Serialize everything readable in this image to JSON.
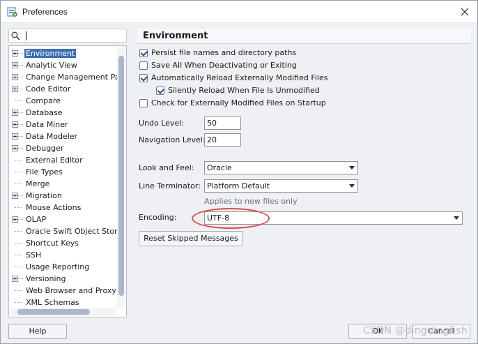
{
  "window": {
    "title": "Preferences",
    "icons": {
      "app": "preferences-app-icon",
      "close": "close-icon"
    }
  },
  "search": {
    "value": "",
    "placeholder": "",
    "icon": "search-icon"
  },
  "tree": {
    "items": [
      {
        "label": "Environment",
        "expandable": true,
        "selected": true
      },
      {
        "label": "Analytic View",
        "expandable": true
      },
      {
        "label": "Change Management Paran",
        "expandable": true
      },
      {
        "label": "Code Editor",
        "expandable": true
      },
      {
        "label": "Compare",
        "expandable": false
      },
      {
        "label": "Database",
        "expandable": true
      },
      {
        "label": "Data Miner",
        "expandable": true
      },
      {
        "label": "Data Modeler",
        "expandable": true
      },
      {
        "label": "Debugger",
        "expandable": true
      },
      {
        "label": "External Editor",
        "expandable": false
      },
      {
        "label": "File Types",
        "expandable": false
      },
      {
        "label": "Merge",
        "expandable": false
      },
      {
        "label": "Migration",
        "expandable": true
      },
      {
        "label": "Mouse Actions",
        "expandable": false
      },
      {
        "label": "OLAP",
        "expandable": true
      },
      {
        "label": "Oracle Swift Object Storage",
        "expandable": false
      },
      {
        "label": "Shortcut Keys",
        "expandable": false
      },
      {
        "label": "SSH",
        "expandable": false
      },
      {
        "label": "Usage Reporting",
        "expandable": false
      },
      {
        "label": "Versioning",
        "expandable": true
      },
      {
        "label": "Web Browser and Proxy",
        "expandable": false
      },
      {
        "label": "XML Schemas",
        "expandable": false
      }
    ]
  },
  "environment": {
    "title": "Environment",
    "checkboxes": [
      {
        "label": "Persist file names and directory paths",
        "checked": true
      },
      {
        "label": "Save All When Deactivating or Exiting",
        "checked": false
      },
      {
        "label": "Automatically Reload Externally Modified Files",
        "checked": true
      },
      {
        "label": "Silently Reload When File Is Unmodified",
        "checked": true
      },
      {
        "label": "Check for Externally Modified Files on Startup",
        "checked": false
      }
    ],
    "undo_level": {
      "label": "Undo Level:",
      "value": "50"
    },
    "navigation_level": {
      "label": "Navigation Level:",
      "value": "20"
    },
    "look_and_feel": {
      "label": "Look and Feel:",
      "value": "Oracle"
    },
    "line_terminator": {
      "label": "Line Terminator:",
      "value": "Platform Default",
      "hint": "Applies to new files only"
    },
    "encoding": {
      "label": "Encoding:",
      "value": "UTF-8"
    },
    "reset_button": "Reset Skipped Messages"
  },
  "footer": {
    "help": "Help",
    "ok": "OK",
    "cancel": "Cancel",
    "watermark": "CSDN @dingdingfish"
  },
  "colors": {
    "selection": "#3d6fb0",
    "highlight_ring": "#e0474c"
  }
}
